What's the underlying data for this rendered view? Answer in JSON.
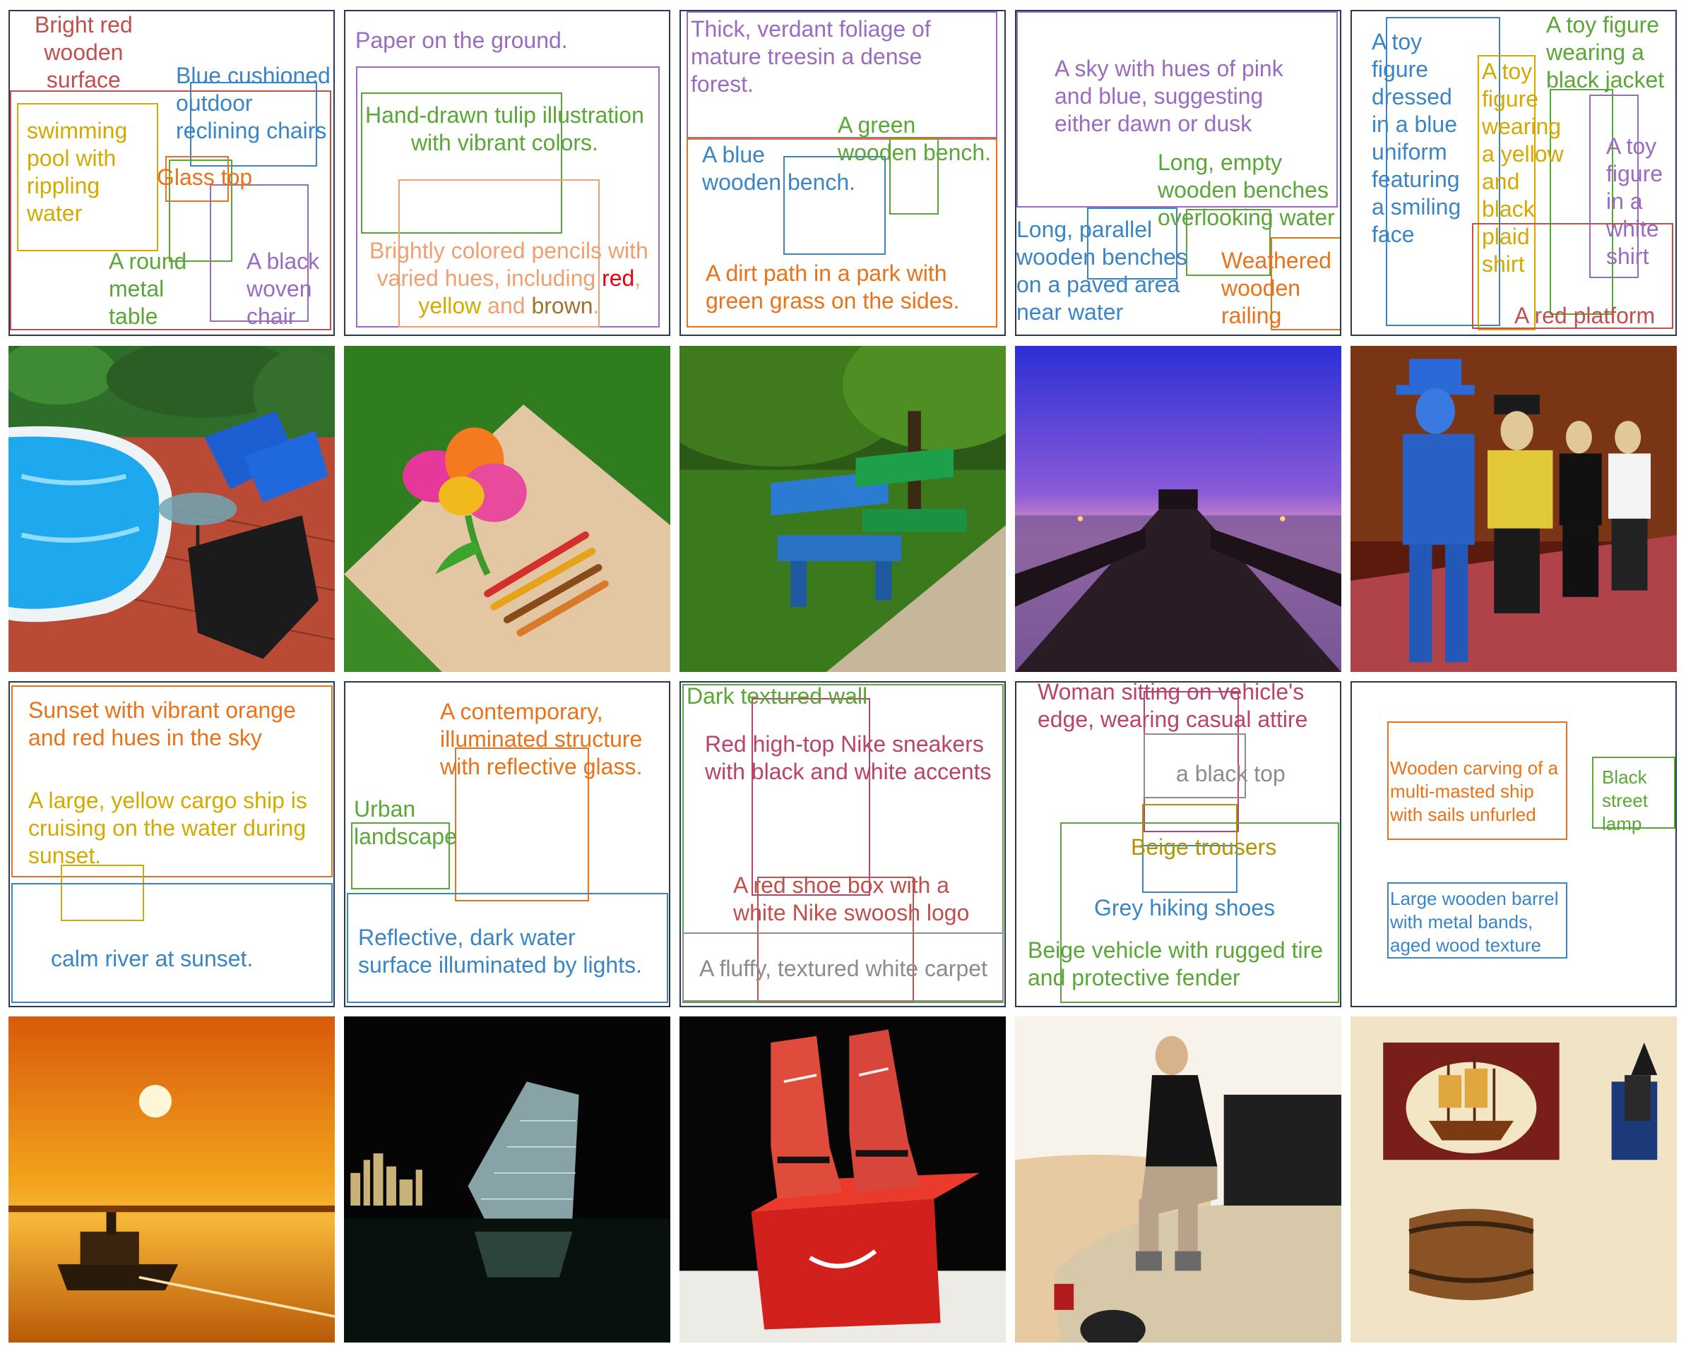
{
  "colors": {
    "red": "#c0504d",
    "blue": "#3a85c6",
    "orange": "#e8731a",
    "green": "#5aa637",
    "purple": "#9b6bc2",
    "gold": "#d4aa00",
    "salmon": "#f0a070",
    "magenta": "#b8446b",
    "olive": "#b09400",
    "grey": "#8c8c8c",
    "brown": "#a0522d"
  },
  "panels": [
    {
      "id": "pool",
      "labels": [
        {
          "text": "Bright red\nwooden\nsurface",
          "color": "red"
        },
        {
          "text": "Blue cushioned\noutdoor\nreclining chairs",
          "color": "blue"
        },
        {
          "text": "swimming\npool with\nrippling\nwater",
          "color": "gold"
        },
        {
          "text": "Glass top",
          "color": "orange"
        },
        {
          "text": "A round\nmetal\ntable",
          "color": "green"
        },
        {
          "text": "A black\nwoven\nchair",
          "color": "purple"
        }
      ]
    },
    {
      "id": "tulip",
      "labels": [
        {
          "text": "Paper on the ground.",
          "color": "purple"
        },
        {
          "text": "Hand-drawn tulip illustration\nwith vibrant colors.",
          "color": "green"
        },
        {
          "pre": "Brightly colored pencils with\nvaried hues, including ",
          "c1": "red",
          "mid": ", ",
          "c2": "yellow",
          "mid2": " and ",
          "c3": "brown",
          "post": ".",
          "color": "salmon"
        }
      ]
    },
    {
      "id": "park",
      "labels": [
        {
          "text": "Thick, verdant foliage of\nmature treesin a dense\nforest.",
          "color": "purple"
        },
        {
          "text": "A green\nwooden bench.",
          "color": "green"
        },
        {
          "text": "A blue\nwooden bench.",
          "color": "blue"
        },
        {
          "text": "A dirt path in a park with\ngreen grass on the sides.",
          "color": "orange"
        }
      ]
    },
    {
      "id": "pier",
      "labels": [
        {
          "text": "A sky with hues of pink\nand blue, suggesting\neither dawn or dusk",
          "color": "purple"
        },
        {
          "text": "Long, empty\nwooden benches\noverlooking water",
          "color": "green"
        },
        {
          "text": "Long, parallel\nwooden benches\non a paved area\nnear water",
          "color": "blue"
        },
        {
          "text": "Weathered\nwooden\nrailing",
          "color": "orange"
        }
      ]
    },
    {
      "id": "toys",
      "labels": [
        {
          "text": "A toy\nfigure\ndressed\nin a blue\nuniform\nfeaturing\na smiling\nface",
          "color": "blue"
        },
        {
          "text": "A toy figure\nwearing a\nblack jacket",
          "color": "green"
        },
        {
          "text": "A toy\nfigure\nwearing\na yellow\nand\nblack\nplaid\nshirt",
          "color": "gold"
        },
        {
          "text": "A toy\nfigure\nin a\nwhite\nshirt",
          "color": "purple"
        },
        {
          "text": "A red platform",
          "color": "red"
        }
      ]
    },
    {
      "id": "sunset",
      "labels": [
        {
          "text": "Sunset with vibrant orange\nand red hues in the sky",
          "color": "orange"
        },
        {
          "text": "A large, yellow cargo ship is\ncruising on the water during\nsunset.",
          "color": "gold"
        },
        {
          "text": "calm river at sunset.",
          "color": "blue"
        }
      ]
    },
    {
      "id": "city",
      "labels": [
        {
          "text": "A contemporary,\nilluminated structure\nwith reflective glass.",
          "color": "orange"
        },
        {
          "text": "Urban\nlandscape",
          "color": "green"
        },
        {
          "text": "Reflective, dark water\nsurface illuminated by lights.",
          "color": "blue"
        }
      ]
    },
    {
      "id": "nike",
      "labels": [
        {
          "text": "Dark textured wall",
          "color": "green"
        },
        {
          "text": "Red high-top Nike sneakers\nwith black and white accents",
          "color": "magenta"
        },
        {
          "text": "A red shoe box with a\nwhite Nike swoosh logo",
          "color": "red"
        },
        {
          "text": "A fluffy, textured white carpet",
          "color": "grey"
        }
      ]
    },
    {
      "id": "woman",
      "labels": [
        {
          "text": "Woman sitting on vehicle's\nedge, wearing casual attire",
          "color": "magenta"
        },
        {
          "text": "a black top",
          "color": "grey"
        },
        {
          "text": "Beige trousers",
          "color": "olive"
        },
        {
          "text": "Grey hiking shoes",
          "color": "blue"
        },
        {
          "text": "Beige vehicle with rugged tire\nand protective fender",
          "color": "green"
        }
      ]
    },
    {
      "id": "ship",
      "labels": [
        {
          "text": "Wooden carving of a\nmulti-masted ship\nwith sails unfurled",
          "color": "orange"
        },
        {
          "text": "Black\nstreet\nlamp",
          "color": "green"
        },
        {
          "text": "Large wooden barrel\nwith metal bands,\naged wood texture",
          "color": "blue"
        }
      ]
    }
  ],
  "images": [
    {
      "id": "pool-img",
      "icon": "pool-scene"
    },
    {
      "id": "tulip-img",
      "icon": "tulip-drawing"
    },
    {
      "id": "park-img",
      "icon": "park-benches"
    },
    {
      "id": "pier-img",
      "icon": "pier-dusk"
    },
    {
      "id": "toys-img",
      "icon": "toy-figures"
    },
    {
      "id": "sunset-img",
      "icon": "cargo-ship-sunset"
    },
    {
      "id": "city-img",
      "icon": "glass-building-night"
    },
    {
      "id": "nike-img",
      "icon": "nike-sneakers-box"
    },
    {
      "id": "woman-img",
      "icon": "woman-on-vehicle"
    },
    {
      "id": "ship-img",
      "icon": "ship-carving-barrel"
    }
  ]
}
